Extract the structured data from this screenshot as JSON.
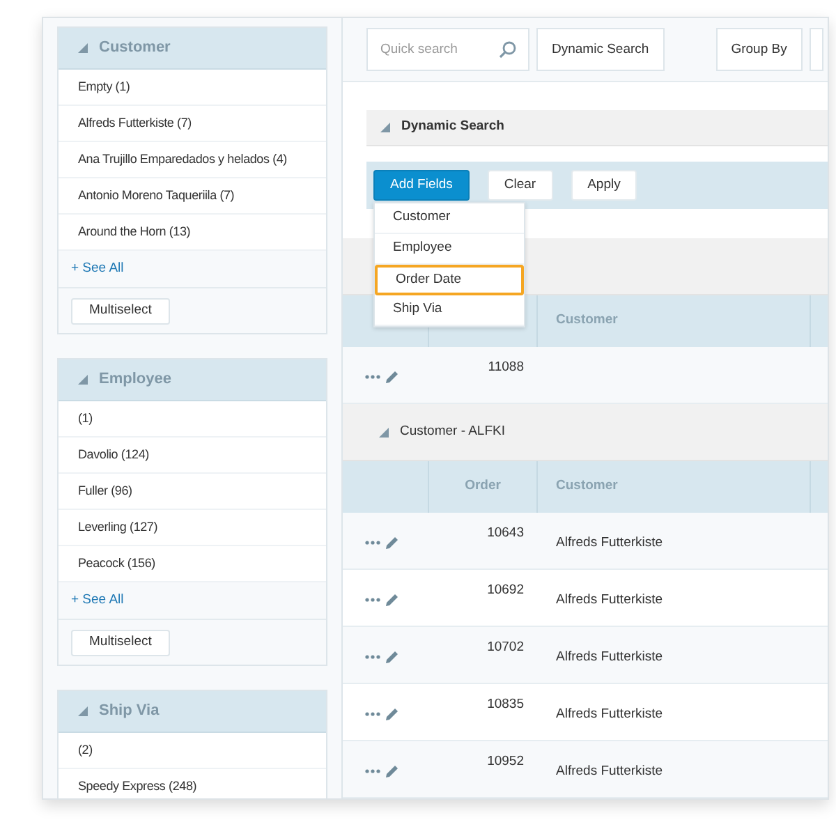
{
  "sidebar": {
    "facets": [
      {
        "title": "Customer",
        "expanded": true,
        "items": [
          "Empty (1)",
          "Alfreds Futterkiste (7)",
          "Ana Trujillo Emparedados y helados (4)",
          "Antonio Moreno Taqueriila (7)",
          "Around the Horn (13)"
        ],
        "see_all": "+ See All",
        "button": "Multiselect"
      },
      {
        "title": "Employee",
        "expanded": true,
        "items": [
          "(1)",
          "Davolio (124)",
          "Fuller (96)",
          "Leverling (127)",
          "Peacock (156)"
        ],
        "see_all": "+ See All",
        "button": "Multiselect"
      },
      {
        "title": "Ship Via",
        "expanded": true,
        "items": [
          "(2)",
          "Speedy Express (248)"
        ]
      }
    ]
  },
  "toolbar": {
    "search": {
      "placeholder": "Quick search"
    },
    "buttons": [
      "Dynamic Search",
      "Group By"
    ]
  },
  "dynamic_search": {
    "title": "Dynamic Search",
    "expanded": true,
    "buttons": [
      {
        "label": "Add Fields",
        "kind": "primary"
      },
      {
        "label": "Clear",
        "kind": "plain"
      },
      {
        "label": "Apply",
        "kind": "plain"
      }
    ],
    "menu": [
      {
        "label": "Customer",
        "selected": false
      },
      {
        "label": "Employee",
        "selected": false
      },
      {
        "label": "Order Date",
        "selected": true
      },
      {
        "label": "Ship Via",
        "selected": false
      }
    ]
  },
  "groups": [
    {
      "header": {
        "customer": "Customer"
      },
      "rows": [
        {
          "order": "11088"
        }
      ]
    },
    {
      "title": "Customer - ALFKI",
      "expanded": true,
      "header": {
        "order": "Order",
        "customer": "Customer"
      },
      "rows": [
        {
          "order": "10643",
          "customer": "Alfreds Futterkiste"
        },
        {
          "order": "10692",
          "customer": "Alfreds Futterkiste"
        },
        {
          "order": "10702",
          "customer": "Alfreds Futterkiste"
        },
        {
          "order": "10835",
          "customer": "Alfreds Futterkiste"
        },
        {
          "order": "10952",
          "customer": "Alfreds Futterkiste"
        }
      ]
    }
  ]
}
